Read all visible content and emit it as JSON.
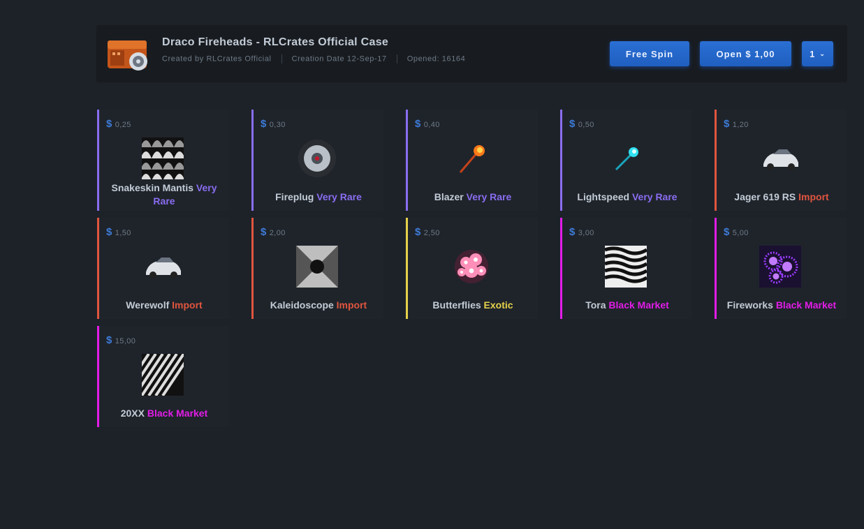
{
  "header": {
    "title": "Draco Fireheads - RLCrates Official Case",
    "created_by": "Created by RLCrates Official",
    "creation_date": "Creation Date 12-Sep-17",
    "opened": "Opened: 16164",
    "free_spin_label": "Free Spin",
    "open_label": "Open $ 1,00",
    "quantity": "1"
  },
  "currency_symbol": "$",
  "items": [
    {
      "price": "0,25",
      "name": "Snakeskin Mantis",
      "rarity": "Very Rare",
      "icon": "snakeskin-decal"
    },
    {
      "price": "0,30",
      "name": "Fireplug",
      "rarity": "Very Rare",
      "icon": "wheel"
    },
    {
      "price": "0,40",
      "name": "Blazer",
      "rarity": "Very Rare",
      "icon": "fire-trail"
    },
    {
      "price": "0,50",
      "name": "Lightspeed",
      "rarity": "Very Rare",
      "icon": "cyan-trail"
    },
    {
      "price": "1,20",
      "name": "Jager 619 RS",
      "rarity": "Import",
      "icon": "car"
    },
    {
      "price": "1,50",
      "name": "Werewolf",
      "rarity": "Import",
      "icon": "car"
    },
    {
      "price": "2,00",
      "name": "Kaleidoscope",
      "rarity": "Import",
      "icon": "kaleidoscope-decal"
    },
    {
      "price": "2,50",
      "name": "Butterflies",
      "rarity": "Exotic",
      "icon": "flowers"
    },
    {
      "price": "3,00",
      "name": "Tora",
      "rarity": "Black Market",
      "icon": "tiger-stripes"
    },
    {
      "price": "5,00",
      "name": "Fireworks",
      "rarity": "Black Market",
      "icon": "fireworks"
    },
    {
      "price": "15,00",
      "name": "20XX",
      "rarity": "Black Market",
      "icon": "stripes-decal"
    }
  ],
  "colors": {
    "very_rare": "#8a6df0",
    "import": "#e0553e",
    "exotic": "#e6d24a",
    "black_market": "#e21ce8",
    "accent": "#2a6fd4"
  }
}
